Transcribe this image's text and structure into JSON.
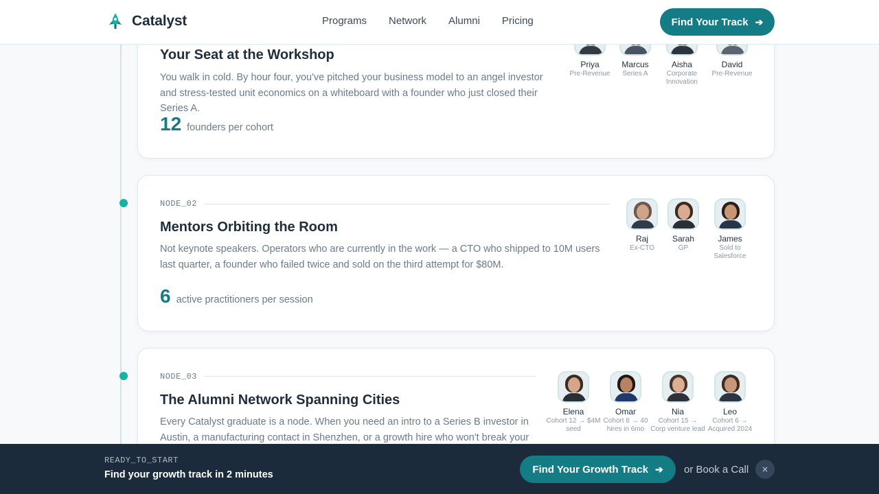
{
  "header": {
    "brand": "Catalyst",
    "nav": [
      "Programs",
      "Network",
      "Alumni",
      "Pricing"
    ],
    "cta_label": "Find Your Track",
    "cta_icon": "arrow-right-icon",
    "logo_icon": "rocket-icon"
  },
  "cards": [
    {
      "title": "Your Seat at the Workshop",
      "desc": "You walk in cold. By hour four, you've pitched your business model to an angel investor and stress-tested unit economics on a whiteboard with a founder who just closed their Series A.",
      "stat_value": "12",
      "stat_caption": "founders per cohort",
      "people": [
        {
          "name": "Priya",
          "role": "Pre-Revenue"
        },
        {
          "name": "Marcus",
          "role": "Series A"
        },
        {
          "name": "Aisha",
          "role": "Corporate Innovation"
        },
        {
          "name": "David",
          "role": "Pre-Revenue"
        }
      ]
    },
    {
      "node": "NODE_02",
      "title": "Mentors Orbiting the Room",
      "desc": "Not keynote speakers. Operators who are currently in the work — a CTO who shipped to 10M users last quarter, a founder who failed twice and sold on the third attempt for $80M.",
      "stat_value": "6",
      "stat_caption": "active practitioners per session",
      "people": [
        {
          "name": "Raj",
          "role": "Ex-CTO"
        },
        {
          "name": "Sarah",
          "role": "GP"
        },
        {
          "name": "James",
          "role": "Sold to Salesforce"
        }
      ]
    },
    {
      "node": "NODE_03",
      "title": "The Alumni Network Spanning Cities",
      "desc": "Every Catalyst graduate is a node. When you need an intro to a Series B investor in Austin, a manufacturing contact in Shenzhen, or a growth hire who won't break your",
      "people": [
        {
          "name": "Elena",
          "role": "Cohort 12 → $4M seed"
        },
        {
          "name": "Omar",
          "role": "Cohort 8 → 40 hires in 6mo"
        },
        {
          "name": "Nia",
          "role": "Cohort 15 → Corp venture lead"
        },
        {
          "name": "Leo",
          "role": "Cohort 6 → Acquired 2024"
        }
      ]
    }
  ],
  "bottom_bar": {
    "eyebrow": "READY_TO_START",
    "title": "Find your growth track in 2 minutes",
    "cta_label": "Find Your Growth Track",
    "secondary_link": "or Book a Call",
    "close_label": "×"
  },
  "colors": {
    "accent": "#137c84",
    "dot": "#14b3a4",
    "bar_bg": "#1c2b3b"
  }
}
